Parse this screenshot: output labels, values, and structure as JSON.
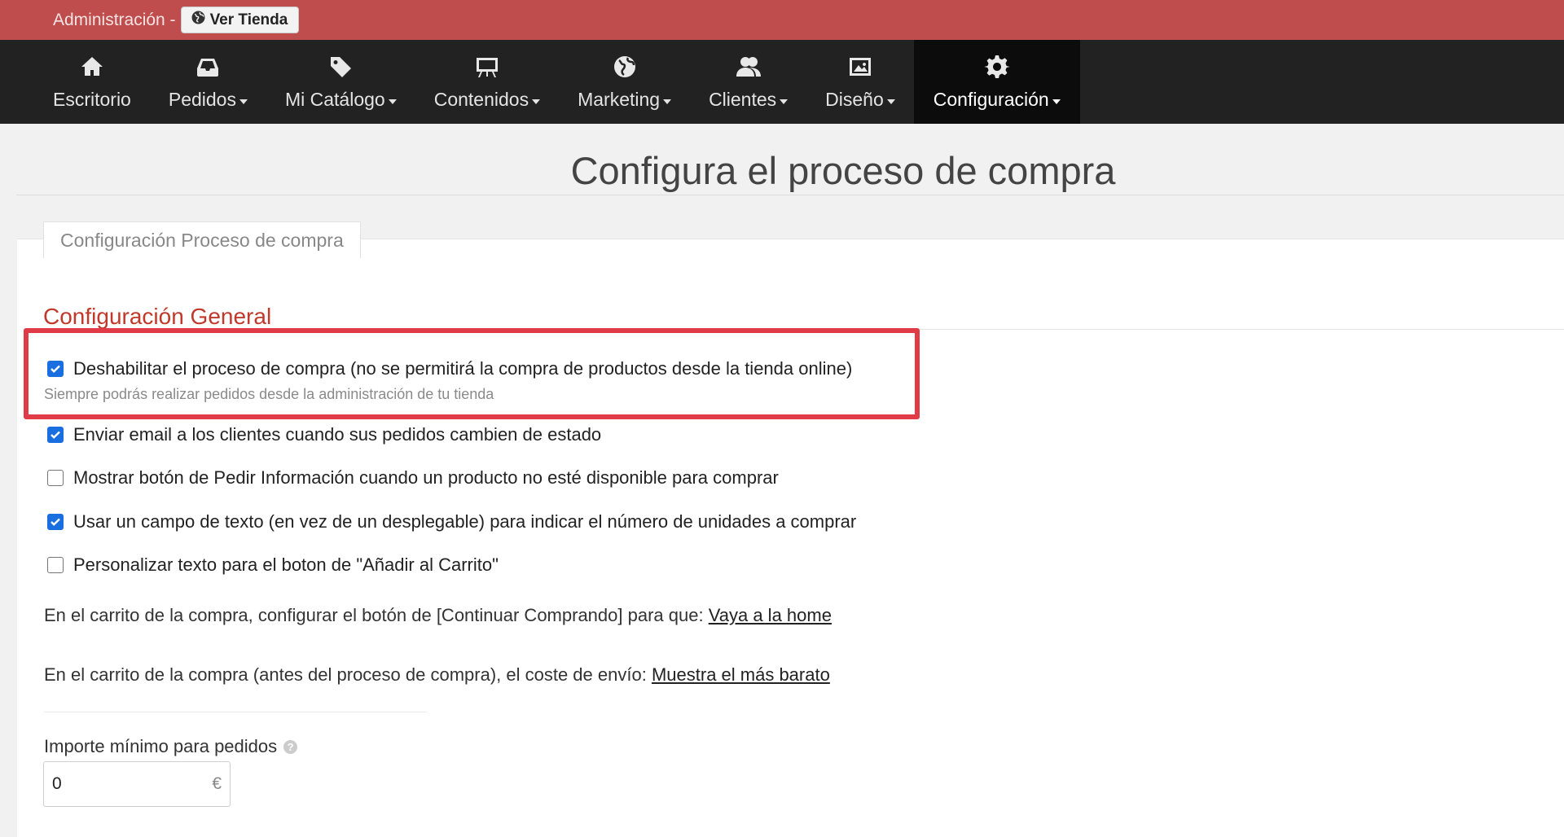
{
  "topbar": {
    "admin_label": "Administración -",
    "view_store_label": "Ver Tienda"
  },
  "nav": {
    "items": [
      {
        "label": "Escritorio",
        "icon": "home-icon",
        "has_caret": false
      },
      {
        "label": "Pedidos",
        "icon": "inbox-icon",
        "has_caret": true
      },
      {
        "label": "Mi Catálogo",
        "icon": "tag-icon",
        "has_caret": true
      },
      {
        "label": "Contenidos",
        "icon": "easel-icon",
        "has_caret": true
      },
      {
        "label": "Marketing",
        "icon": "globe-icon",
        "has_caret": true
      },
      {
        "label": "Clientes",
        "icon": "users-icon",
        "has_caret": true
      },
      {
        "label": "Diseño",
        "icon": "image-icon",
        "has_caret": true
      },
      {
        "label": "Configuración",
        "icon": "gear-icon",
        "has_caret": true,
        "active": true
      }
    ]
  },
  "page": {
    "title": "Configura el proceso de compra",
    "tab_label": "Configuración Proceso de compra",
    "section_title": "Configuración General"
  },
  "options": [
    {
      "label": "Deshabilitar el proceso de compra (no se permitirá la compra de productos desde la tienda online)",
      "checked": true
    },
    {
      "label": "Enviar email a los clientes cuando sus pedidos cambien de estado",
      "checked": true
    },
    {
      "label": "Mostrar botón de Pedir Información cuando un producto no esté disponible para comprar",
      "checked": false
    },
    {
      "label": "Usar un campo de texto (en vez de un desplegable) para indicar el número de unidades a comprar",
      "checked": true
    },
    {
      "label": "Personalizar texto para el boton de \"Añadir al Carrito\"",
      "checked": false
    }
  ],
  "hint": "Siempre podrás realizar pedidos desde la administración de tu tienda",
  "cart_continue": {
    "text": "En el carrito de la compra, configurar el botón de [Continuar Comprando] para que:",
    "link": "Vaya a la home"
  },
  "cart_shipping": {
    "text": "En el carrito de la compra (antes del proceso de compra), el coste de envío:",
    "link": "Muestra el más barato"
  },
  "min_order": {
    "label": "Importe mínimo para pedidos",
    "value": "0",
    "unit": "€"
  },
  "colors": {
    "topbar": "#bf4d4d",
    "navbar": "#222222",
    "accent_red": "#c0392b",
    "highlight": "#e13b48",
    "checkbox": "#1a6fe0"
  }
}
